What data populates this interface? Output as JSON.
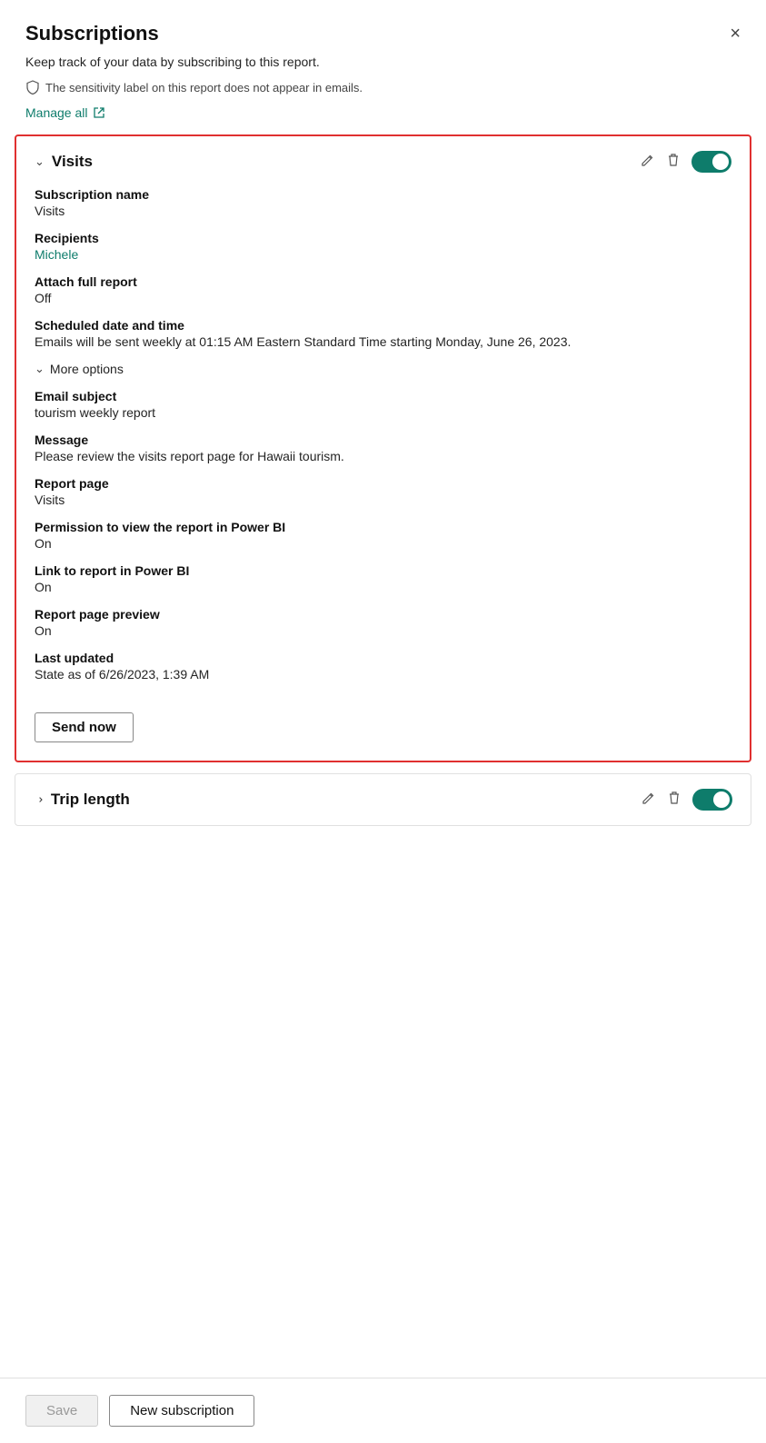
{
  "header": {
    "title": "Subscriptions",
    "close_label": "×"
  },
  "subtitle": "Keep track of your data by subscribing to this report.",
  "sensitivity_note": "The sensitivity label on this report does not appear in emails.",
  "manage_all": "Manage all",
  "subscriptions": [
    {
      "id": "visits",
      "name": "Visits",
      "expanded": true,
      "enabled": true,
      "fields": [
        {
          "label": "Subscription name",
          "value": "Visits",
          "type": "text"
        },
        {
          "label": "Recipients",
          "value": "Michele",
          "type": "link"
        },
        {
          "label": "Attach full report",
          "value": "Off",
          "type": "text"
        },
        {
          "label": "Scheduled date and time",
          "value": "Emails will be sent weekly at 01:15 AM Eastern Standard Time starting Monday, June 26, 2023.",
          "type": "text"
        }
      ],
      "more_options_label": "More options",
      "more_options_fields": [
        {
          "label": "Email subject",
          "value": "tourism weekly report",
          "type": "text"
        },
        {
          "label": "Message",
          "value": "Please review the visits report page for Hawaii tourism.",
          "type": "text"
        },
        {
          "label": "Report page",
          "value": "Visits",
          "type": "text"
        },
        {
          "label": "Permission to view the report in Power BI",
          "value": "On",
          "type": "text"
        },
        {
          "label": "Link to report in Power BI",
          "value": "On",
          "type": "text"
        },
        {
          "label": "Report page preview",
          "value": "On",
          "type": "text"
        },
        {
          "label": "Last updated",
          "value": "State as of 6/26/2023, 1:39 AM",
          "type": "text"
        }
      ],
      "send_now_label": "Send now"
    },
    {
      "id": "trip-length",
      "name": "Trip length",
      "expanded": false,
      "enabled": true
    }
  ],
  "footer": {
    "save_label": "Save",
    "new_subscription_label": "New subscription"
  }
}
